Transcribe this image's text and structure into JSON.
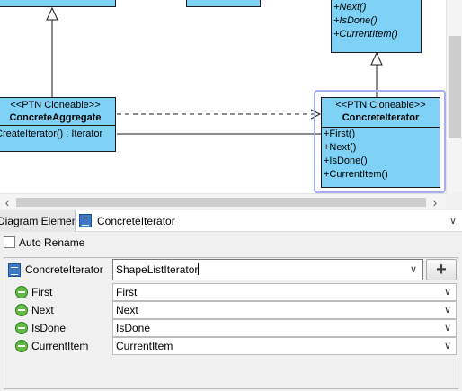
{
  "diagram": {
    "aggregate": {
      "stereotype": "<<PTN Cloneable>>",
      "name": "ConcreteAggregate",
      "operations": [
        "CreateIterator() : Iterator"
      ]
    },
    "iterator": {
      "stereotype": "<<PTN Cloneable>>",
      "name": "ConcreteIterator",
      "operations": [
        "+First()",
        "+Next()",
        "+IsDone()",
        "+CurrentItem()"
      ]
    },
    "abstract_iterator_operations": [
      "+Next()",
      "+IsDone()",
      "+CurrentItem()"
    ]
  },
  "panel": {
    "tab_label": "Diagram Element",
    "title": "ConcreteIterator",
    "auto_rename_label": "Auto Rename",
    "auto_rename_checked": false
  },
  "properties": {
    "class_label": "ConcreteIterator",
    "class_value": "ShapeListIterator",
    "add_label": "+",
    "operations": [
      {
        "label": "First",
        "value": "First"
      },
      {
        "label": "Next",
        "value": "Next"
      },
      {
        "label": "IsDone",
        "value": "IsDone"
      },
      {
        "label": "CurrentItem",
        "value": "CurrentItem"
      }
    ]
  },
  "icons": {
    "dropdown_arrow": "chevron-down-icon",
    "class_icon": "class-icon",
    "operation_icon": "operation-icon",
    "scroll_left": "chevron-left-icon",
    "scroll_right": "chevron-right-icon"
  },
  "colors": {
    "uml_fill": "#7fd2f5",
    "selection": "#a6aef0",
    "operation_icon": "#5fbb44",
    "class_icon": "#3b78c6"
  }
}
